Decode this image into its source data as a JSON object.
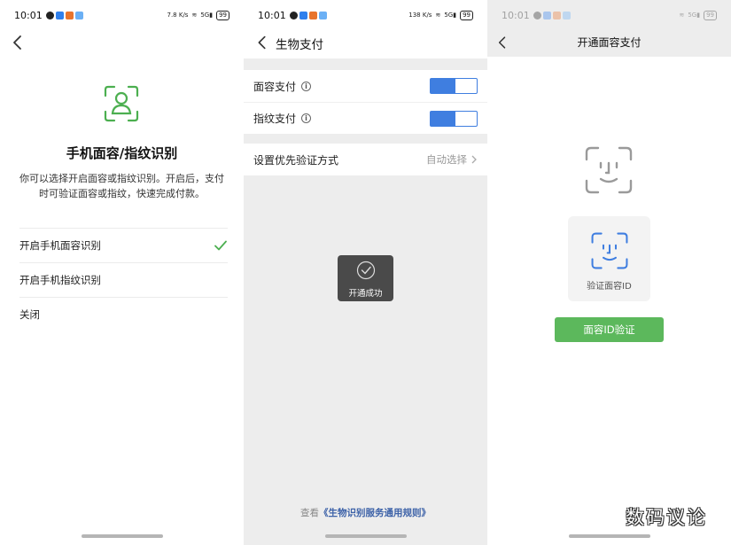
{
  "status_bar": {
    "time": "10:01",
    "net_speed_1": "7.8 K/s",
    "net_speed_2": "138 K/s",
    "network": "5G",
    "battery": "99"
  },
  "screen1": {
    "title": "手机面容/指纹识别",
    "description": "你可以选择开启面容或指纹识别。开启后，支付时可验证面容或指纹，快速完成付款。",
    "options": [
      {
        "label": "开启手机面容识别",
        "selected": true
      },
      {
        "label": "开启手机指纹识别",
        "selected": false
      },
      {
        "label": "关闭",
        "selected": false
      }
    ],
    "accent_color": "#4caf50"
  },
  "screen2": {
    "title": "生物支付",
    "face_pay_label": "面容支付",
    "finger_pay_label": "指纹支付",
    "face_pay_on": true,
    "finger_pay_on": true,
    "priority_label": "设置优先验证方式",
    "priority_value": "自动选择",
    "toast_text": "开通成功",
    "footer_prefix": "查看",
    "footer_link": "《生物识别服务通用规则》",
    "toggle_color": "#3f7ee0"
  },
  "screen3": {
    "title": "开通面容支付",
    "card_label": "验证面容ID",
    "button_label": "面容ID验证",
    "button_color": "#5cb85c"
  },
  "watermark": "数码议论"
}
